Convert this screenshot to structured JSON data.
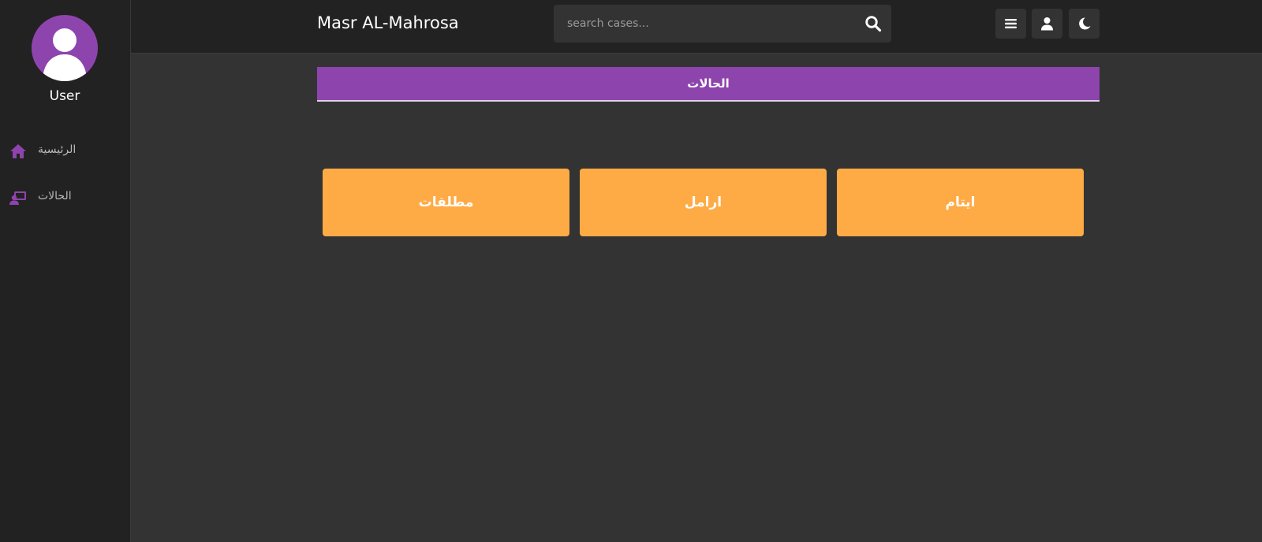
{
  "user": {
    "name": "User"
  },
  "sidebar": {
    "items": [
      {
        "label": "الرئيسية",
        "icon": "home-icon"
      },
      {
        "label": "الحالات",
        "icon": "cases-icon"
      }
    ]
  },
  "header": {
    "title": "Masr AL-Mahrosa",
    "search_placeholder": "search cases...",
    "buttons": [
      "menu-icon",
      "user-icon",
      "moon-icon"
    ]
  },
  "section": {
    "title": "الحالات"
  },
  "cards": [
    {
      "label": "مطلقات"
    },
    {
      "label": "ارامل"
    },
    {
      "label": "ايتام"
    }
  ],
  "colors": {
    "accent": "#8e44ad",
    "card": "#ffab45",
    "background": "#333333",
    "sidebar": "#222222"
  }
}
